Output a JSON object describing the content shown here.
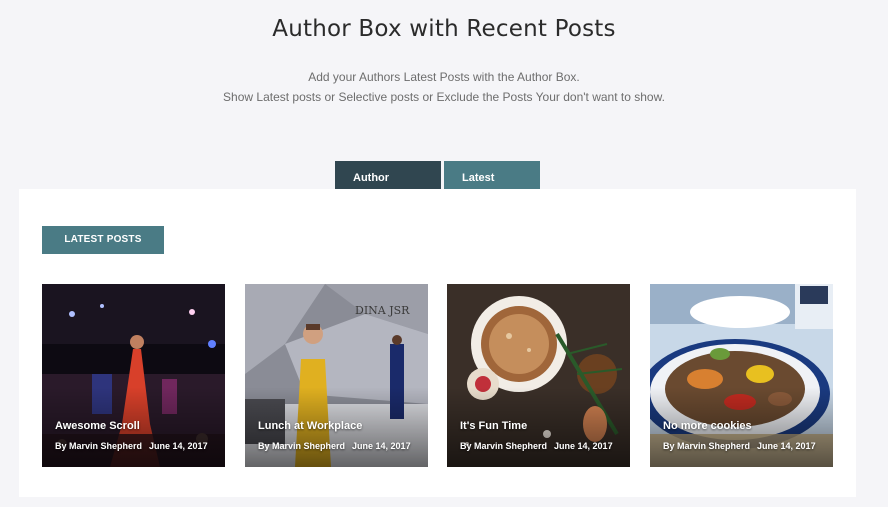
{
  "header": {
    "title": "Author Box with Recent Posts",
    "subtitle_line1": "Add your Authors Latest Posts with the Author Box.",
    "subtitle_line2": "Show Latest posts or Selective posts or Exclude the Posts Your don't want to show."
  },
  "tabs": [
    {
      "label": "Author Details",
      "active": false
    },
    {
      "label": "Latest Posts",
      "active": true
    }
  ],
  "panel": {
    "heading": "LATEST POSTS",
    "posts": [
      {
        "title": "Awesome Scroll",
        "author": "By Marvin Shepherd",
        "date": "June 14, 2017",
        "image": "fashion-runway-red-gown"
      },
      {
        "title": "Lunch at Workplace",
        "author": "By Marvin Shepherd",
        "date": "June 14, 2017",
        "image": "fashion-runway-yellow-dress"
      },
      {
        "title": "It's Fun Time",
        "author": "By Marvin Shepherd",
        "date": "June 14, 2017",
        "image": "hot-chocolate-cookies"
      },
      {
        "title": "No more cookies",
        "author": "By Marvin Shepherd",
        "date": "June 14, 2017",
        "image": "asian-food-plate"
      }
    ],
    "image_text": "DINA JSR"
  },
  "colors": {
    "accent_teal": "#4a7b85",
    "dark_tab": "#304650",
    "background": "#f5f5f8"
  }
}
